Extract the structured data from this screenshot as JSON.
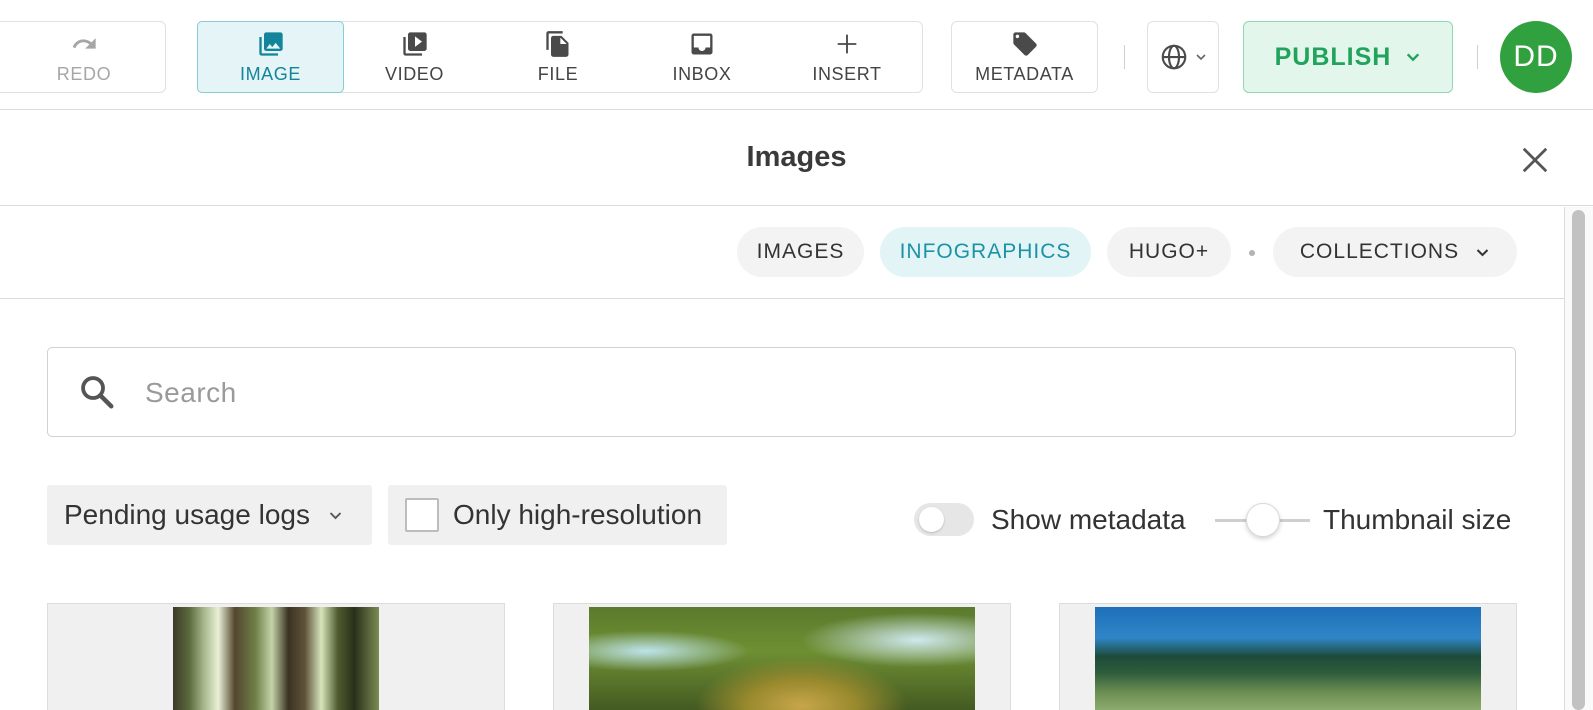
{
  "toolbar": {
    "redo_label": "REDO",
    "buttons": [
      {
        "label": "IMAGE",
        "icon": "image-icon",
        "active": true
      },
      {
        "label": "VIDEO",
        "icon": "video-icon"
      },
      {
        "label": "FILE",
        "icon": "file-icon"
      },
      {
        "label": "INBOX",
        "icon": "inbox-icon"
      },
      {
        "label": "INSERT",
        "icon": "plus-icon"
      }
    ],
    "metadata_label": "METADATA",
    "publish_label": "PUBLISH",
    "avatar_initials": "DD"
  },
  "panel": {
    "title": "Images",
    "tabs": [
      {
        "label": "IMAGES"
      },
      {
        "label": "INFOGRAPHICS",
        "active": true
      },
      {
        "label": "HUGO+"
      },
      {
        "label": "COLLECTIONS"
      }
    ],
    "search": {
      "placeholder": "Search",
      "value": ""
    },
    "filters": {
      "usage_dropdown": "Pending usage logs",
      "high_res_label": "Only high-resolution",
      "high_res_checked": false,
      "show_metadata_label": "Show metadata",
      "show_metadata_on": false,
      "thumbnail_size_label": "Thumbnail size"
    }
  },
  "colors": {
    "accent": "#13859a",
    "publish": "#21a35c",
    "avatar": "#31a13f"
  }
}
